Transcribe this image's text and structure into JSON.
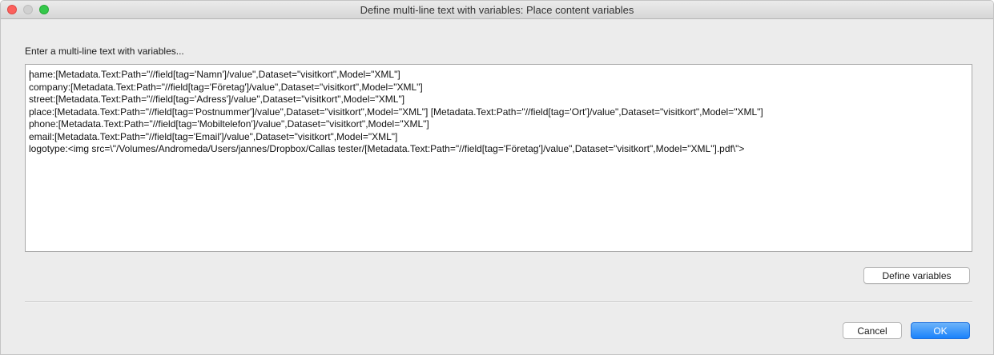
{
  "window": {
    "title": "Define multi-line text with variables: Place  content variables"
  },
  "prompt": "Enter a multi-line text with variables...",
  "editor": {
    "lines": [
      "name:[Metadata.Text:Path=\"//field[tag='Namn']/value\",Dataset=\"visitkort\",Model=\"XML\"]",
      "company:[Metadata.Text:Path=\"//field[tag='Företag']/value\",Dataset=\"visitkort\",Model=\"XML\"]",
      "street:[Metadata.Text:Path=\"//field[tag='Adress']/value\",Dataset=\"visitkort\",Model=\"XML\"]",
      "place:[Metadata.Text:Path=\"//field[tag='Postnummer']/value\",Dataset=\"visitkort\",Model=\"XML\"] [Metadata.Text:Path=\"//field[tag='Ort']/value\",Dataset=\"visitkort\",Model=\"XML\"]",
      "phone:[Metadata.Text:Path=\"//field[tag='Mobiltelefon']/value\",Dataset=\"visitkort\",Model=\"XML\"]",
      "email:[Metadata.Text:Path=\"//field[tag='Email']/value\",Dataset=\"visitkort\",Model=\"XML\"]",
      "logotype:<img src=\\\"/Volumes/Andromeda/Users/jannes/Dropbox/Callas tester/[Metadata.Text:Path=\"//field[tag='Företag']/value\",Dataset=\"visitkort\",Model=\"XML\"].pdf\\\">"
    ]
  },
  "buttons": {
    "define_variables": "Define variables",
    "cancel": "Cancel",
    "ok": "OK"
  },
  "colors": {
    "accent": "#1a82fb",
    "close": "#fc605c",
    "minimize_disabled": "#d0d0d0",
    "maximize": "#34c84a"
  }
}
